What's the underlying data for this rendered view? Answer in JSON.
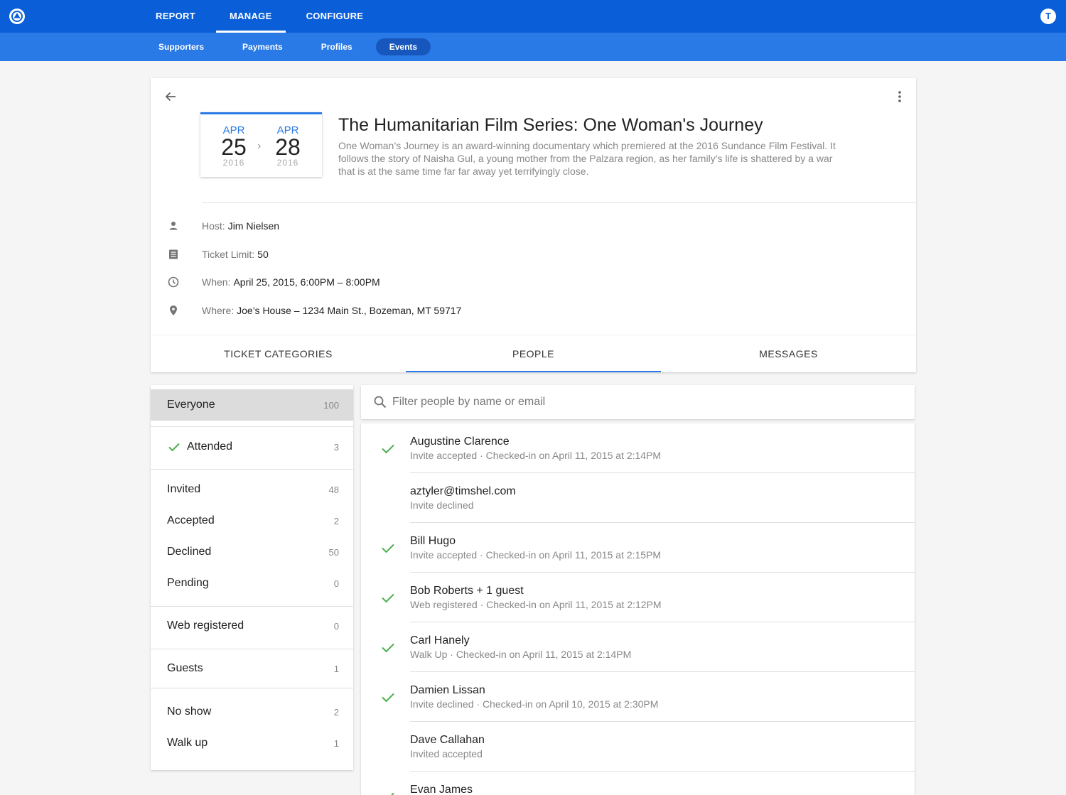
{
  "topnav": {
    "items": [
      {
        "label": "REPORT",
        "active": false
      },
      {
        "label": "MANAGE",
        "active": true
      },
      {
        "label": "CONFIGURE",
        "active": false
      }
    ],
    "user_initial": "T"
  },
  "subnav": {
    "items": [
      {
        "label": "Supporters",
        "active": false
      },
      {
        "label": "Payments",
        "active": false
      },
      {
        "label": "Profiles",
        "active": false
      },
      {
        "label": "Events",
        "active": true
      }
    ]
  },
  "event": {
    "start": {
      "month": "APR",
      "day": "25",
      "year": "2016"
    },
    "end": {
      "month": "APR",
      "day": "28",
      "year": "2016"
    },
    "title": "The Humanitarian Film Series: One Woman's Journey",
    "description": "One Woman’s Journey is an award-winning documentary which premiered at the 2016 Sundance Film Festival. It follows the story of Naisha Gul, a young mother from the Palzara region, as her family’s life is shattered by a war that is at the same time far far away yet terrifyingly close.",
    "host": {
      "label": "Host:",
      "value": "Jim Nielsen"
    },
    "ticket_limit": {
      "label": "Ticket Limit:",
      "value": "50"
    },
    "when": {
      "label": "When:",
      "value": "April 25, 2015, 6:00PM – 8:00PM"
    },
    "where": {
      "label": "Where:",
      "value": "Joe’s House – 1234 Main St., Bozeman, MT 59717"
    }
  },
  "tabs": [
    {
      "label": "TICKET CATEGORIES",
      "active": false
    },
    {
      "label": "PEOPLE",
      "active": true
    },
    {
      "label": "MESSAGES",
      "active": false
    }
  ],
  "filters": {
    "everyone": {
      "label": "Everyone",
      "count": "100"
    },
    "attended": {
      "label": "Attended",
      "count": "3"
    },
    "invited": {
      "label": "Invited",
      "count": "48"
    },
    "accepted": {
      "label": "Accepted",
      "count": "2"
    },
    "declined": {
      "label": "Declined",
      "count": "50"
    },
    "pending": {
      "label": "Pending",
      "count": "0"
    },
    "web_registered": {
      "label": "Web registered",
      "count": "0"
    },
    "guests": {
      "label": "Guests",
      "count": "1"
    },
    "no_show": {
      "label": "No show",
      "count": "2"
    },
    "walk_up": {
      "label": "Walk up",
      "count": "1"
    }
  },
  "search": {
    "placeholder": "Filter people by name or email",
    "value": ""
  },
  "people": [
    {
      "name": "Augustine Clarence",
      "status": "Invite accepted · Checked-in on April 11, 2015 at 2:14PM",
      "checked_in": true
    },
    {
      "name": "aztyler@timshel.com",
      "status": "Invite declined",
      "checked_in": false
    },
    {
      "name": "Bill Hugo",
      "status": "Invite accepted · Checked-in on April 11, 2015 at 2:15PM",
      "checked_in": true
    },
    {
      "name": "Bob Roberts + 1 guest",
      "status": "Web registered · Checked-in on April 11, 2015 at 2:12PM",
      "checked_in": true
    },
    {
      "name": "Carl Hanely",
      "status": "Walk Up · Checked-in on April 11, 2015 at 2:14PM",
      "checked_in": true
    },
    {
      "name": "Damien Lissan",
      "status": "Invite declined · Checked-in on April 10, 2015 at 2:30PM",
      "checked_in": true
    },
    {
      "name": "Dave Callahan",
      "status": "Invited accepted",
      "checked_in": false
    },
    {
      "name": "Evan James",
      "status": "",
      "checked_in": true
    }
  ],
  "colors": {
    "primary": "#0a5fd8",
    "secondary": "#2979e6",
    "check_green": "#4caf50"
  }
}
